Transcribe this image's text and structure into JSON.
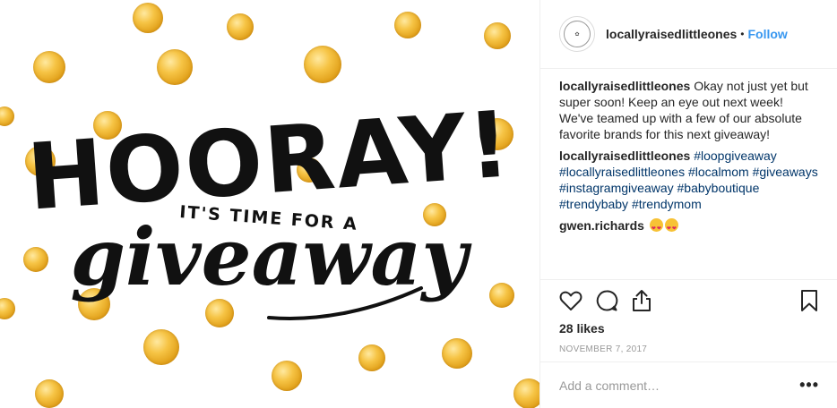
{
  "post": {
    "image": {
      "headline": "HOORAY!",
      "subline": "IT'S TIME FOR A",
      "script_word": "giveaway",
      "dot_color": "#f2b632"
    },
    "header": {
      "username": "locallyraisedlittleones",
      "bullet": "•",
      "follow_label": "Follow"
    },
    "caption": {
      "username": "locallyraisedlittleones",
      "text": "Okay not just yet but super soon! Keep an eye out next week! We've teamed up with a few of our absolute favorite brands for this next giveaway!"
    },
    "hashtag_comment": {
      "username": "locallyraisedlittleones",
      "tags": [
        "#loopgiveaway",
        "#locallyraisedlittleones",
        "#localmom",
        "#giveaways",
        "#instagramgiveaway",
        "#babyboutique",
        "#trendybaby",
        "#trendymom"
      ]
    },
    "reply": {
      "username": "gwen.richards",
      "emoji": [
        "heart-eyes-emoji",
        "heart-eyes-emoji"
      ]
    },
    "likes": "28 likes",
    "date": "NOVEMBER 7, 2017",
    "add_comment_placeholder": "Add a comment…",
    "more_label": "•••",
    "icons": [
      "heart-icon",
      "comment-icon",
      "share-icon",
      "bookmark-icon"
    ],
    "colors": {
      "follow": "#3897f0",
      "hashtag": "#003569",
      "muted": "#999999"
    }
  }
}
